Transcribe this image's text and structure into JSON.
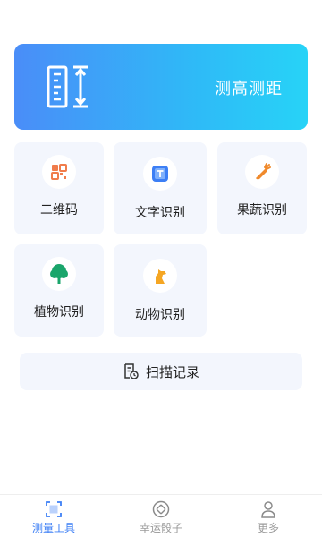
{
  "banner": {
    "title": "测高测距",
    "icon": "ruler-height-icon"
  },
  "tools": [
    {
      "label": "二维码",
      "icon": "qrcode-icon",
      "color": "#f07c4b"
    },
    {
      "label": "文字识别",
      "icon": "text-recognition-icon",
      "color": "#3d7ff5"
    },
    {
      "label": "果蔬识别",
      "icon": "carrot-icon",
      "color": "#f08a2c"
    },
    {
      "label": "植物识别",
      "icon": "tree-icon",
      "color": "#1aa56b"
    },
    {
      "label": "动物识别",
      "icon": "dog-icon",
      "color": "#f5a623"
    }
  ],
  "history": {
    "label": "扫描记录",
    "icon": "history-document-icon"
  },
  "tabbar": {
    "active_color": "#3d7ff5",
    "inactive_color": "#9a9a9a",
    "items": [
      {
        "label": "测量工具",
        "icon": "scan-frame-icon",
        "active": true
      },
      {
        "label": "幸运骰子",
        "icon": "dice-icon",
        "active": false
      },
      {
        "label": "更多",
        "icon": "user-icon",
        "active": false
      }
    ]
  }
}
